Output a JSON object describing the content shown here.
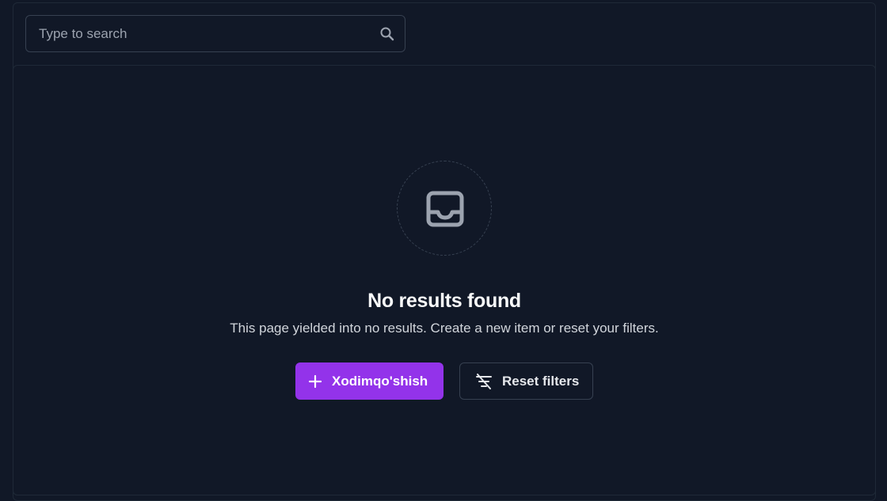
{
  "search": {
    "placeholder": "Type to search",
    "value": "",
    "icon": "search-icon"
  },
  "empty_state": {
    "icon": "inbox-icon",
    "title": "No results found",
    "description": "This page yielded into no results. Create a new item or reset your filters."
  },
  "actions": {
    "create": {
      "label": "Xodimqo'shish",
      "icon": "plus-icon"
    },
    "reset": {
      "label": "Reset filters",
      "icon": "filter-off-icon"
    }
  },
  "colors": {
    "background": "#111827",
    "border": "#1f2937",
    "accent": "#9333ea",
    "text_primary": "#f9fafb",
    "text_secondary": "#d1d5db",
    "placeholder": "#9ca3af",
    "icon_muted": "#9ca3af"
  }
}
